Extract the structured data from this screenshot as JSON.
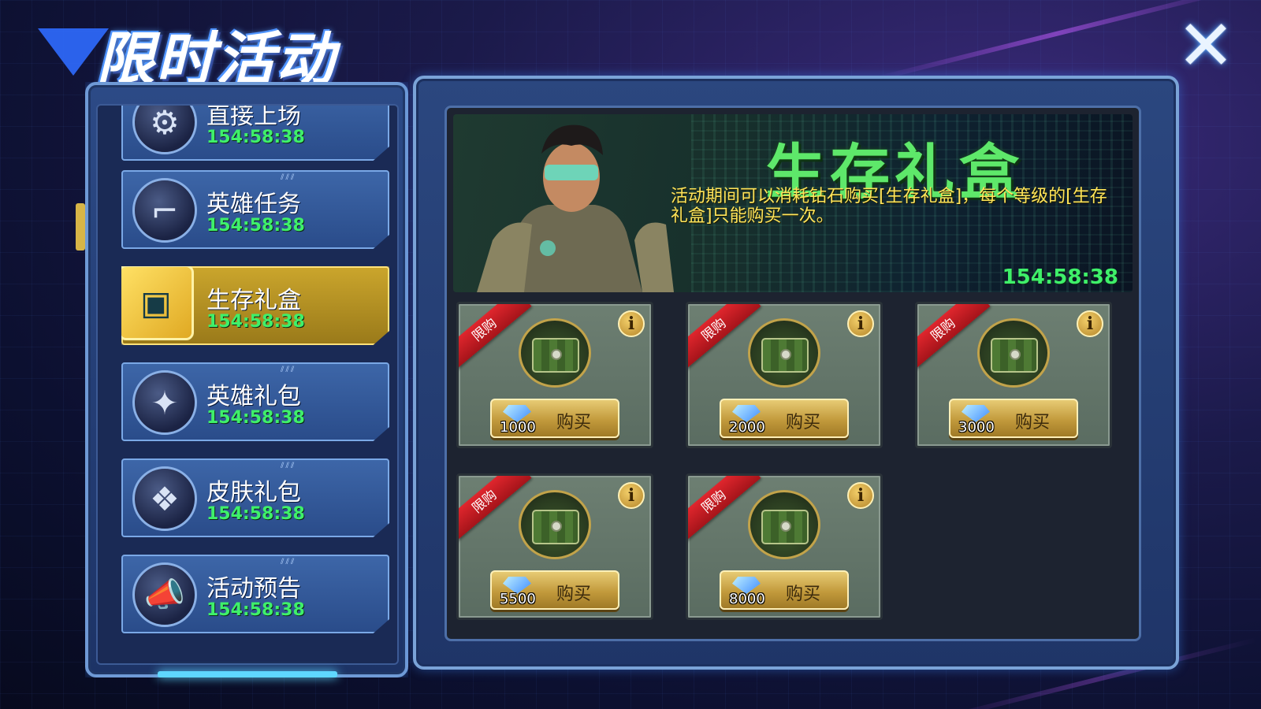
{
  "header": {
    "title": "限时活动",
    "close_symbol": "✕"
  },
  "sidebar": {
    "items": [
      {
        "label": "直接上场",
        "timer": "154:58:38",
        "icon": "cannon-icon",
        "active": false
      },
      {
        "label": "英雄任务",
        "timer": "154:58:38",
        "icon": "revolver-icon",
        "active": false
      },
      {
        "label": "生存礼盒",
        "timer": "154:58:38",
        "icon": "crate-icon",
        "active": true
      },
      {
        "label": "英雄礼包",
        "timer": "154:58:38",
        "icon": "treasure-chest-icon",
        "active": false
      },
      {
        "label": "皮肤礼包",
        "timer": "154:58:38",
        "icon": "skin-pack-icon",
        "active": false
      },
      {
        "label": "活动预告",
        "timer": "154:58:38",
        "icon": "megaphone-icon",
        "active": false
      }
    ]
  },
  "banner": {
    "title": "生存礼盒",
    "description": "活动期间可以消耗钻石购买[生存礼盒]，每个等级的[生存礼盒]只能购买一次。",
    "timer": "154:58:38"
  },
  "shop": {
    "ribbon_label": "限购",
    "buy_label": "购买",
    "info_symbol": "i",
    "items": [
      {
        "price": "1000"
      },
      {
        "price": "2000"
      },
      {
        "price": "3000"
      },
      {
        "price": "5500"
      },
      {
        "price": "8000"
      }
    ]
  },
  "colors": {
    "timer_green": "#3ff06a",
    "banner_title_green": "#5ee86a",
    "description_yellow": "#ffe45a",
    "active_gold": "#caa52c",
    "ribbon_red": "#e0262d"
  }
}
